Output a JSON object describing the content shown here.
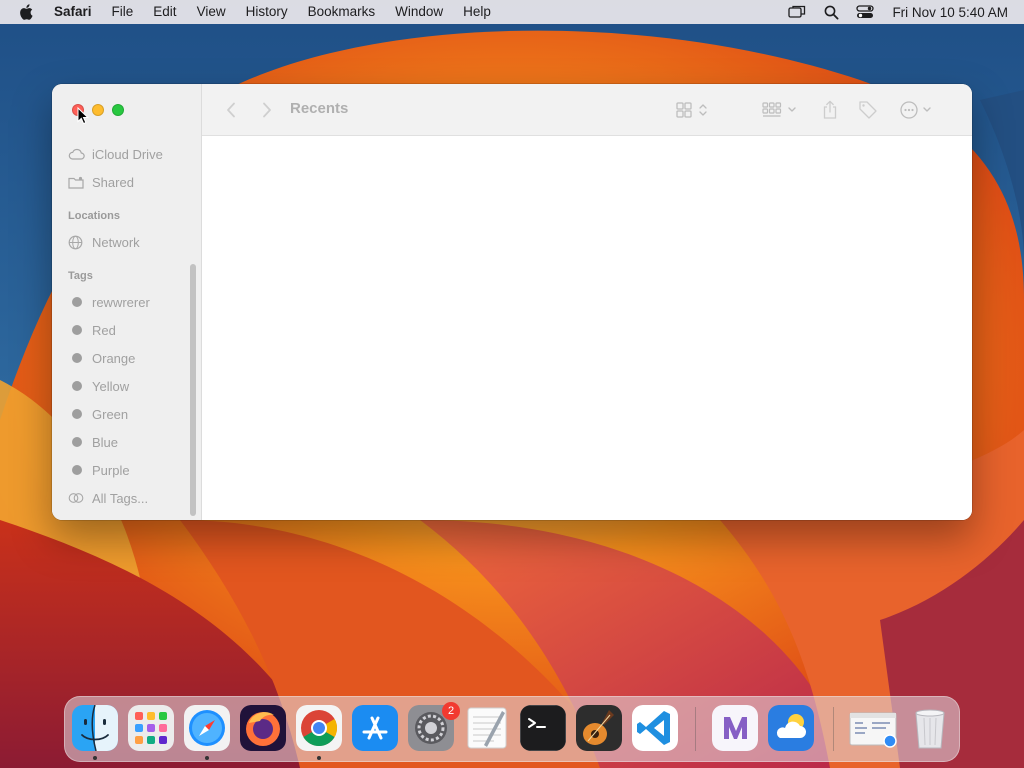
{
  "menubar": {
    "app_name": "Safari",
    "items": [
      "File",
      "Edit",
      "View",
      "History",
      "Bookmarks",
      "Window",
      "Help"
    ],
    "clock": "Fri Nov 10  5:40 AM",
    "status_icons": [
      "screen-mirroring-icon",
      "spotlight-search-icon",
      "control-center-icon"
    ]
  },
  "finder": {
    "title": "Recents",
    "sidebar": {
      "favorites": [
        {
          "label": "iCloud Drive",
          "icon": "cloud-icon"
        },
        {
          "label": "Shared",
          "icon": "shared-folder-icon"
        }
      ],
      "locations_header": "Locations",
      "locations": [
        {
          "label": "Network",
          "icon": "globe-icon"
        }
      ],
      "tags_header": "Tags",
      "tags": [
        {
          "label": "rewwrerer"
        },
        {
          "label": "Red"
        },
        {
          "label": "Orange"
        },
        {
          "label": "Yellow"
        },
        {
          "label": "Green"
        },
        {
          "label": "Blue"
        },
        {
          "label": "Purple"
        }
      ],
      "all_tags": "All Tags..."
    }
  },
  "dock": {
    "badge_system_settings": "2",
    "apps": [
      "Finder",
      "Launchpad",
      "Safari",
      "Firefox",
      "Chrome",
      "App Store",
      "System Settings",
      "TextEdit",
      "Terminal",
      "GarageBand",
      "VS Code",
      "Visual Studio",
      "Weather",
      "Preview",
      "Trash"
    ]
  },
  "colors": {
    "close": "#fe5f57",
    "minimize": "#febc2e",
    "maximize": "#28c840",
    "badge": "#f23a30"
  }
}
